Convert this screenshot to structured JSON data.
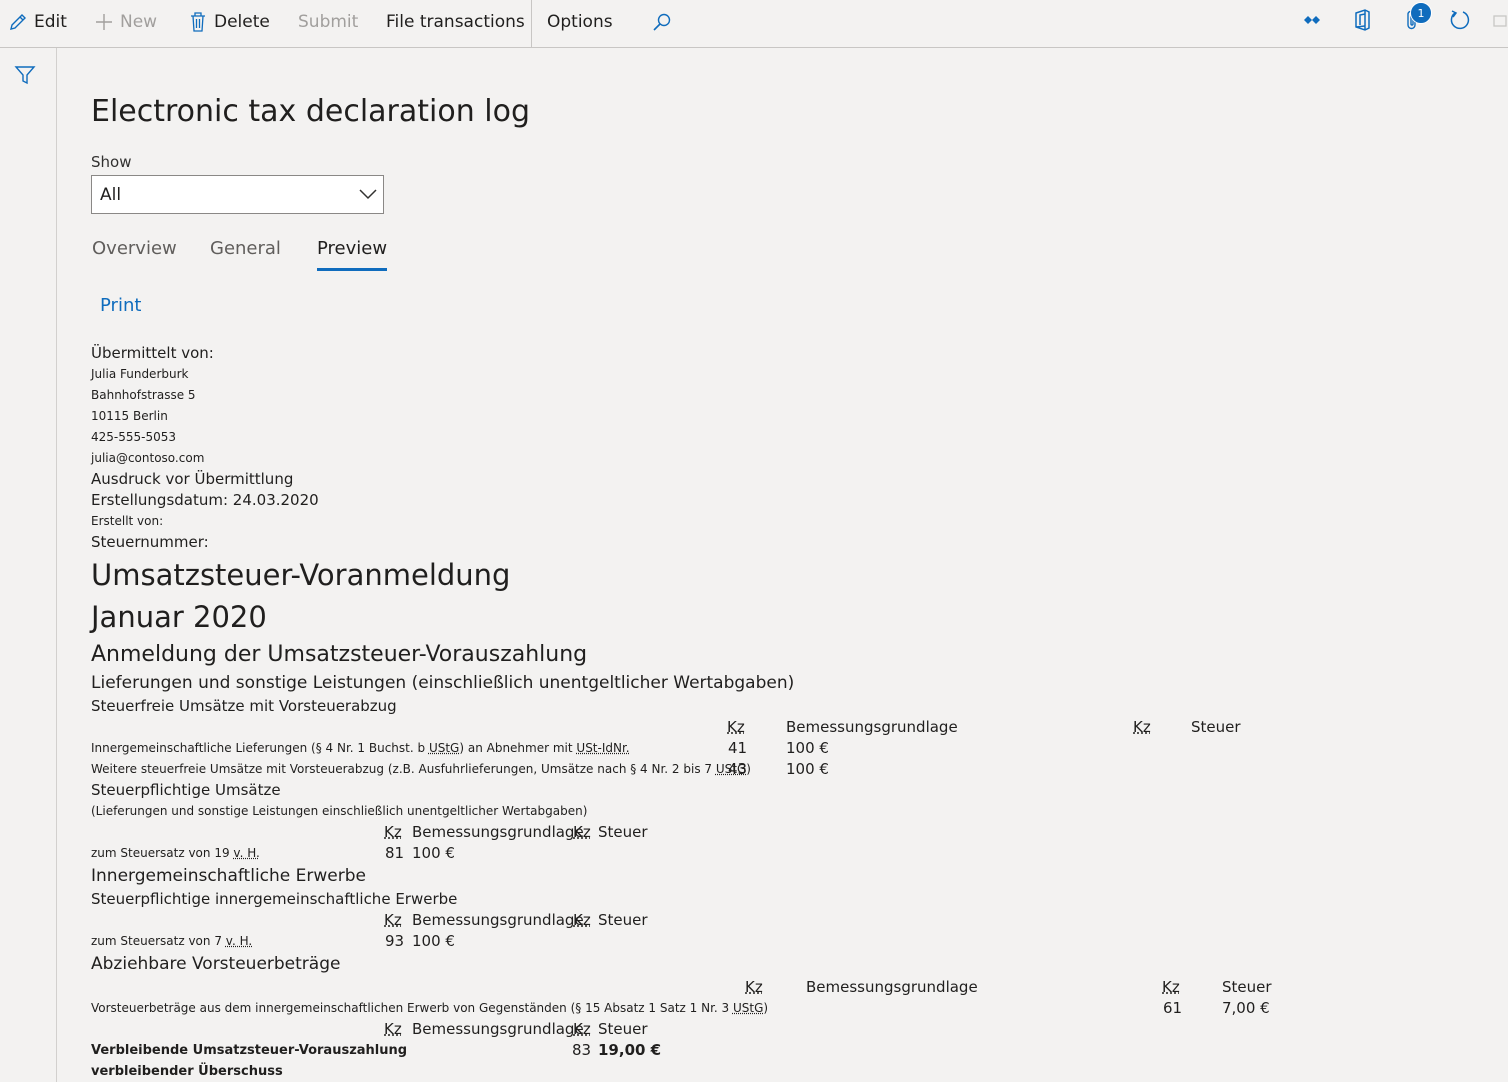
{
  "toolbar": {
    "edit_label": "Edit",
    "new_label": "New",
    "delete_label": "Delete",
    "submit_label": "Submit",
    "file_transactions_label": "File transactions",
    "options_label": "Options",
    "attachments_count": "1"
  },
  "page": {
    "title": "Electronic tax declaration log",
    "show_label": "Show",
    "show_value": "All",
    "tabs": [
      "Overview",
      "General",
      "Preview"
    ],
    "active_tab": "Preview",
    "print_label": "Print"
  },
  "preview": {
    "sender_heading": "Übermittelt von:",
    "sender_name": "Julia Funderburk",
    "sender_street": "Bahnhofstrasse 5",
    "sender_city": "10115 Berlin",
    "sender_phone": "425-555-5053",
    "sender_email": "julia@contoso.com",
    "print_note": "Ausdruck vor Übermittlung",
    "created_date": "Erstellungsdatum: 24.03.2020",
    "created_by": "Erstellt von:",
    "tax_number": "Steuernummer:",
    "doc_title": "Umsatzsteuer-Voranmeldung",
    "period": "Januar 2020",
    "section_main": "Anmeldung der Umsatzsteuer-Vorauszahlung",
    "sub_deliveries": "Lieferungen und sonstige Leistungen (einschließlich unentgeltlicher Wertabgaben)",
    "sub_taxfree": "Steuerfreie Umsätze mit Vorsteuerabzug",
    "col_kz": "Kz",
    "col_base": "Bemessungsgrundlage",
    "col_tax": "Steuer",
    "row41_label_a": "Innergemeinschaftliche Lieferungen (§ 4 Nr. 1 Buchst. b ",
    "row41_abbr1": "UStG",
    "row41_label_b": ") an Abnehmer mit ",
    "row41_abbr2": "USt-IdNr.",
    "row41_kz": "41",
    "row41_base": "100 €",
    "row43_label_a": "Weitere steuerfreie Umsätze mit Vorsteuerabzug (z.B. Ausfuhrlieferungen, Umsätze nach § 4 Nr. 2 bis 7 ",
    "row43_abbr": "UStG",
    "row43_label_b": ")",
    "row43_kz": "43",
    "row43_base": "100 €",
    "sub_taxable": "Steuerpflichtige Umsätze",
    "sub_taxable_note": "(Lieferungen und sonstige Leistungen einschließlich unentgeltlicher Wertabgaben)",
    "row81_label": "zum Steuersatz von 19 ",
    "row81_abbr": "v. H.",
    "row81_kz": "81",
    "row81_base": "100 €",
    "section_ig": "Innergemeinschaftliche Erwerbe",
    "sub_ig_taxable": "Steuerpflichtige innergemeinschaftliche Erwerbe",
    "row93_label": "zum Steuersatz von 7 ",
    "row93_abbr": "v. H.",
    "row93_kz": "93",
    "row93_base": "100 €",
    "section_input": "Abziehbare Vorsteuerbeträge",
    "row61_label_a": "Vorsteuerbeträge aus dem innergemeinschaftlichen Erwerb von Gegenständen (§ 15 Absatz 1 Satz 1 Nr. 3 ",
    "row61_abbr": "UStG",
    "row61_label_b": ")",
    "row61_kz": "61",
    "row61_tax": "7,00 €",
    "row83_label": "Verbleibende Umsatzsteuer-Vorauszahlung",
    "row83_kz": "83",
    "row83_tax": "19,00 €",
    "surplus_label": "verbleibender Überschuss"
  }
}
